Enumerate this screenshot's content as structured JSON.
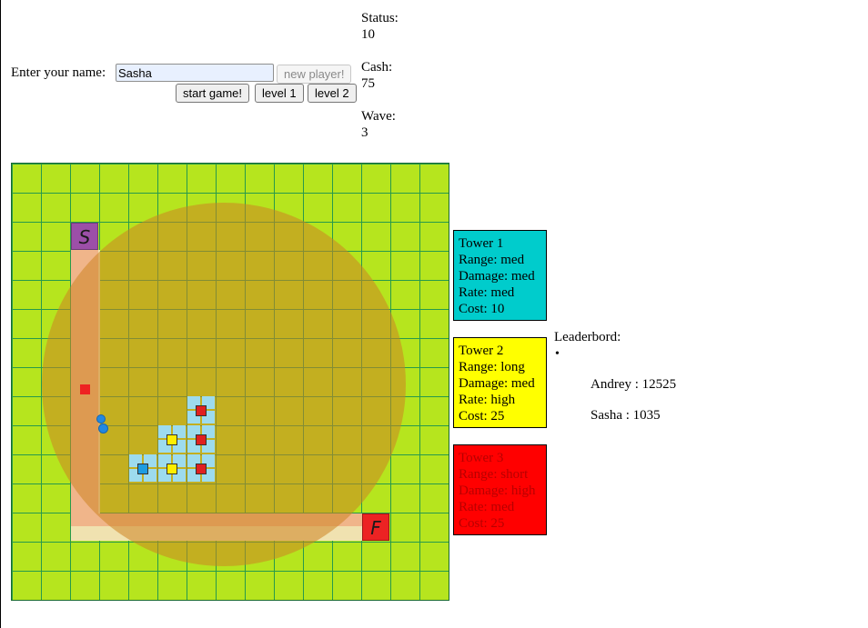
{
  "player": {
    "label": "Enter your name:",
    "name_value": "Sasha"
  },
  "buttons": {
    "new_player": "new player!",
    "start_game": "start game!",
    "level1": "level 1",
    "level2": "level 2"
  },
  "stats": {
    "status_label": "Status:",
    "status_value": "10",
    "cash_label": "Cash:",
    "cash_value": "75",
    "wave_label": "Wave:",
    "wave_value": "3"
  },
  "board": {
    "grid": {
      "cols": 15,
      "rows": 15
    },
    "start_letter": "S",
    "finish_letter": "F",
    "colors": {
      "grass": "#b6e51e",
      "grid_line": "#279a4c",
      "path": "#f0b58a",
      "path_edge": "#f0e2b0",
      "range": "#cd8423",
      "start": "#9c4fa8",
      "finish": "#ec2323"
    }
  },
  "towers": [
    {
      "name": "Tower 1",
      "range": "Range: med",
      "damage": "Damage: med",
      "rate": "Rate: med",
      "cost": "Cost: 10",
      "color": "#00cccc"
    },
    {
      "name": "Tower 2",
      "range": "Range: long",
      "damage": "Damage: med",
      "rate": "Rate: high",
      "cost": "Cost: 25",
      "color": "#ffff00"
    },
    {
      "name": "Tower 3",
      "range": "Range: short",
      "damage": "Damage: high",
      "rate": "Rate: med",
      "cost": "Cost: 25",
      "color": "#ff0000"
    }
  ],
  "leaderboard": {
    "title": "Leaderbord:",
    "bullet": "•",
    "entries": [
      "Andrey : 12525",
      "Sasha : 1035"
    ]
  }
}
